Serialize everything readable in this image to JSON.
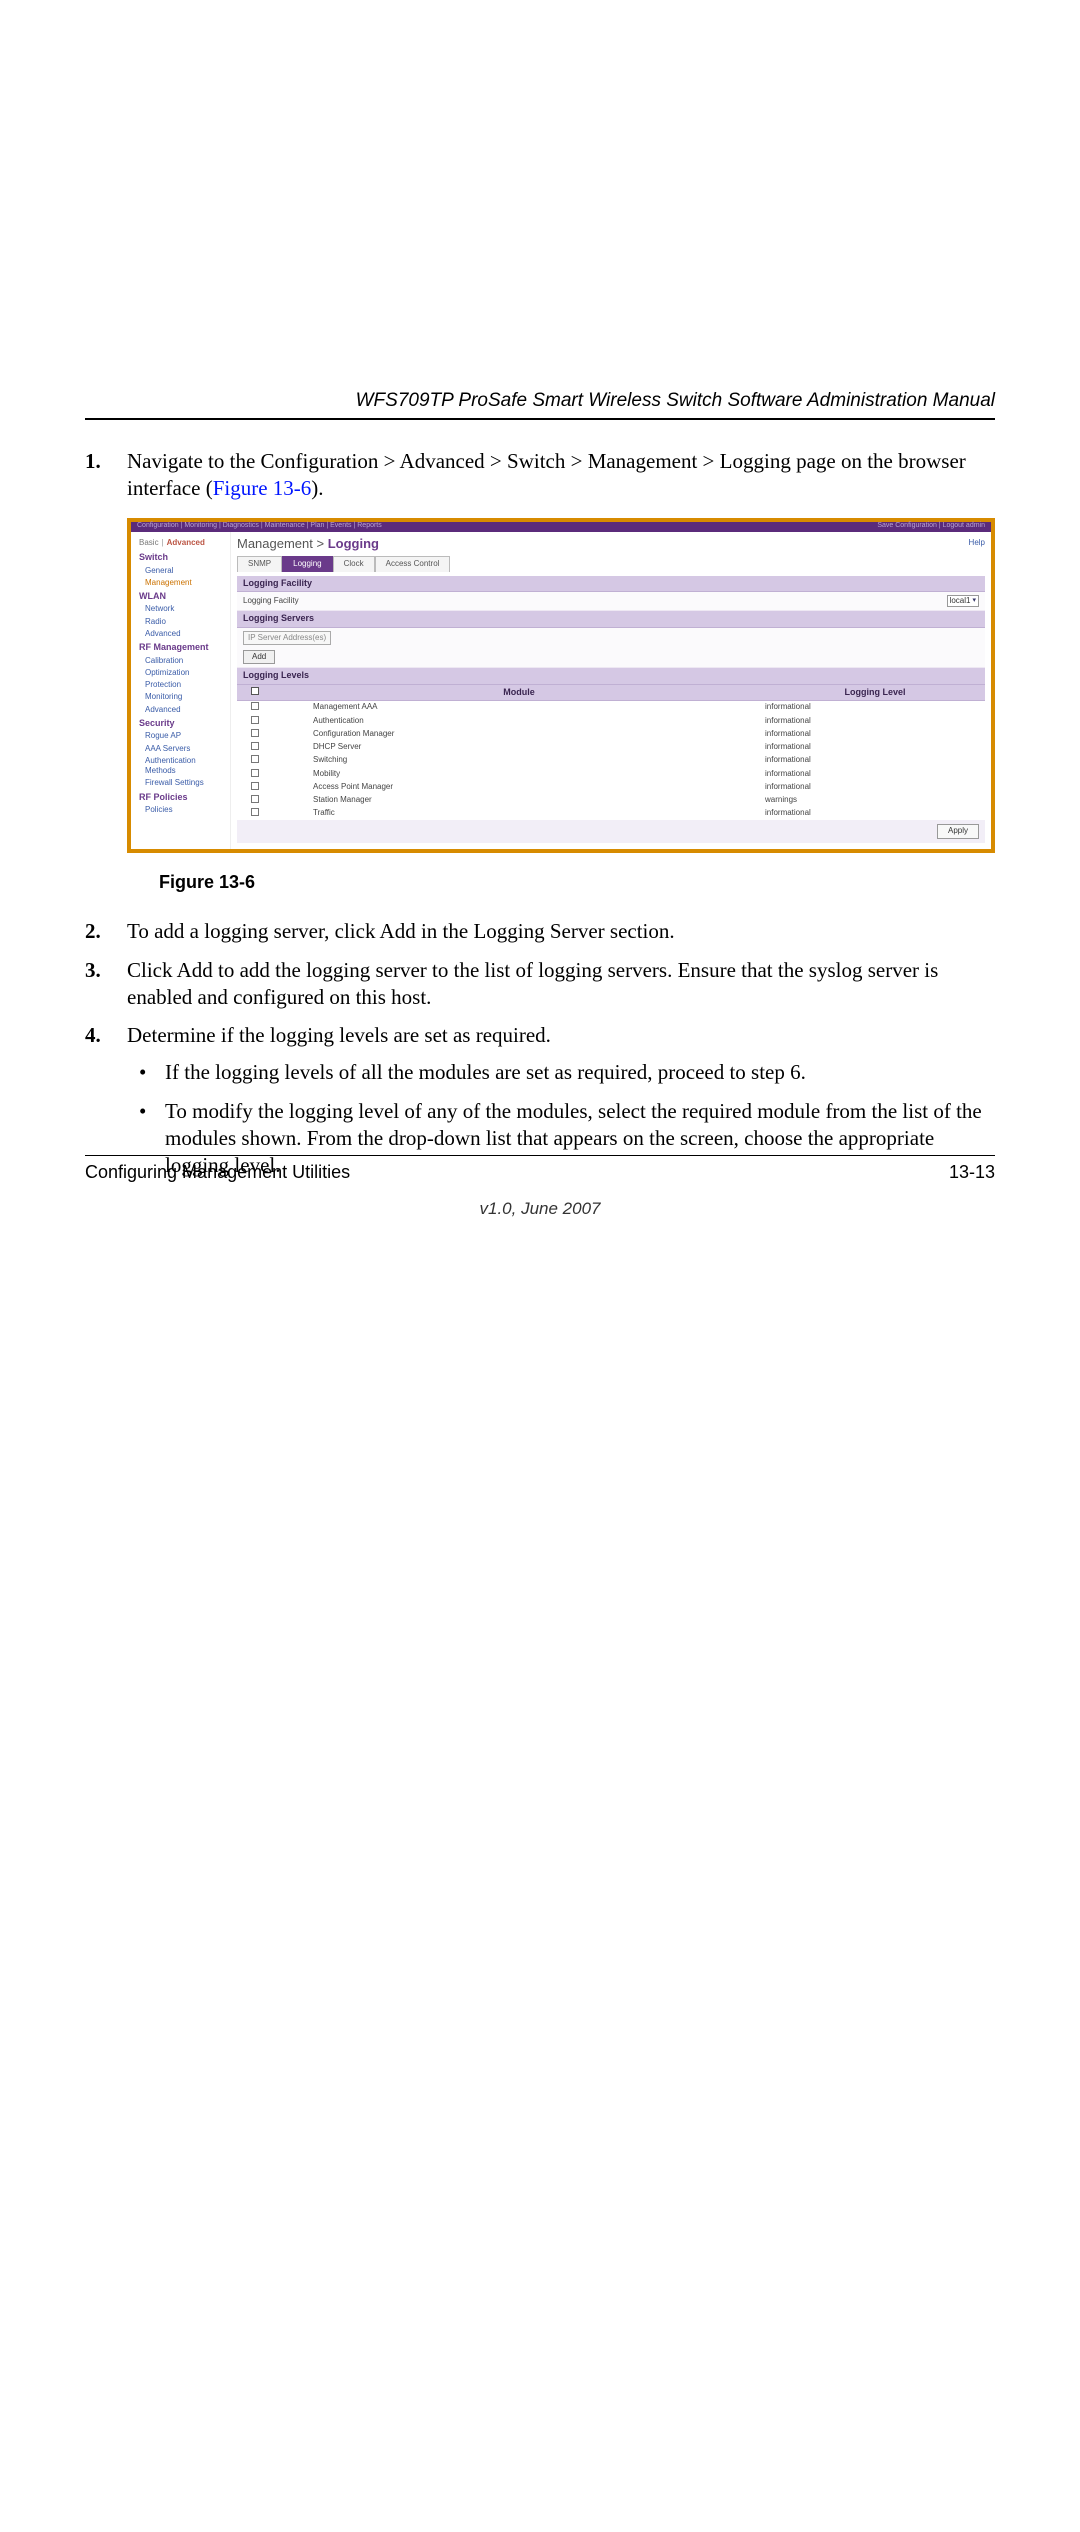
{
  "header": {
    "doc_title": "WFS709TP ProSafe Smart Wireless Switch Software Administration Manual"
  },
  "steps": {
    "s1a": "Navigate to the Configuration > Advanced > Switch > Management > Logging page on the browser interface (",
    "s1_figref": "Figure 13-6",
    "s1b": ").",
    "s2": "To add a logging server, click Add in the Logging Server section.",
    "s3": "Click Add to add the logging server to the list of logging servers. Ensure that the syslog server is enabled and configured on this host.",
    "s4": "Determine if the logging levels are set as required.",
    "b1": "If the logging levels of all the modules are set as required, proceed to step 6.",
    "b2": "To modify the logging level of any of the modules, select the required module from the list of the modules shown. From the drop-down list that appears on the screen, choose the appropriate logging level."
  },
  "figure": {
    "caption": "Figure 13-6",
    "topbar_left": "Configuration  |  Monitoring  |  Diagnostics  |  Maintenance  |  Plan  |  Events  |  Reports",
    "topbar_right": "Save Configuration  |  Logout admin",
    "side_tabs": {
      "basic": "Basic",
      "advanced": "Advanced"
    },
    "sidebar": {
      "switch": "Switch",
      "switch_items": [
        "General",
        "Management"
      ],
      "wlan": "WLAN",
      "wlan_items": [
        "Network",
        "Radio",
        "Advanced"
      ],
      "rf": "RF Management",
      "rf_items": [
        "Calibration",
        "Optimization",
        "Protection",
        "Monitoring",
        "Advanced"
      ],
      "sec": "Security",
      "sec_items": [
        "Rogue AP",
        "AAA Servers",
        "Authentication Methods",
        "Firewall Settings"
      ],
      "rfp": "RF Policies",
      "rfp_items": [
        "Policies"
      ]
    },
    "crumb_a": "Management > ",
    "crumb_b": "Logging",
    "help": "Help",
    "tabs": [
      "SNMP",
      "Logging",
      "Clock",
      "Access Control"
    ],
    "facility_head": "Logging Facility",
    "facility_label": "Logging Facility",
    "facility_value": "local1",
    "servers_head": "Logging Servers",
    "ip_placeholder": "IP  Server  Address(es)",
    "add_btn": "Add",
    "levels_head": "Logging Levels",
    "col_module": "Module",
    "col_level": "Logging Level",
    "rows": [
      {
        "module": "Management AAA",
        "level": "informational"
      },
      {
        "module": "Authentication",
        "level": "informational"
      },
      {
        "module": "Configuration Manager",
        "level": "informational"
      },
      {
        "module": "DHCP Server",
        "level": "informational"
      },
      {
        "module": "Switching",
        "level": "informational"
      },
      {
        "module": "Mobility",
        "level": "informational"
      },
      {
        "module": "Access Point Manager",
        "level": "informational"
      },
      {
        "module": "Station Manager",
        "level": "warnings"
      },
      {
        "module": "Traffic",
        "level": "informational"
      }
    ],
    "apply": "Apply"
  },
  "footer": {
    "left": "Configuring Management Utilities",
    "right": "13-13",
    "version": "v1.0, June 2007"
  }
}
